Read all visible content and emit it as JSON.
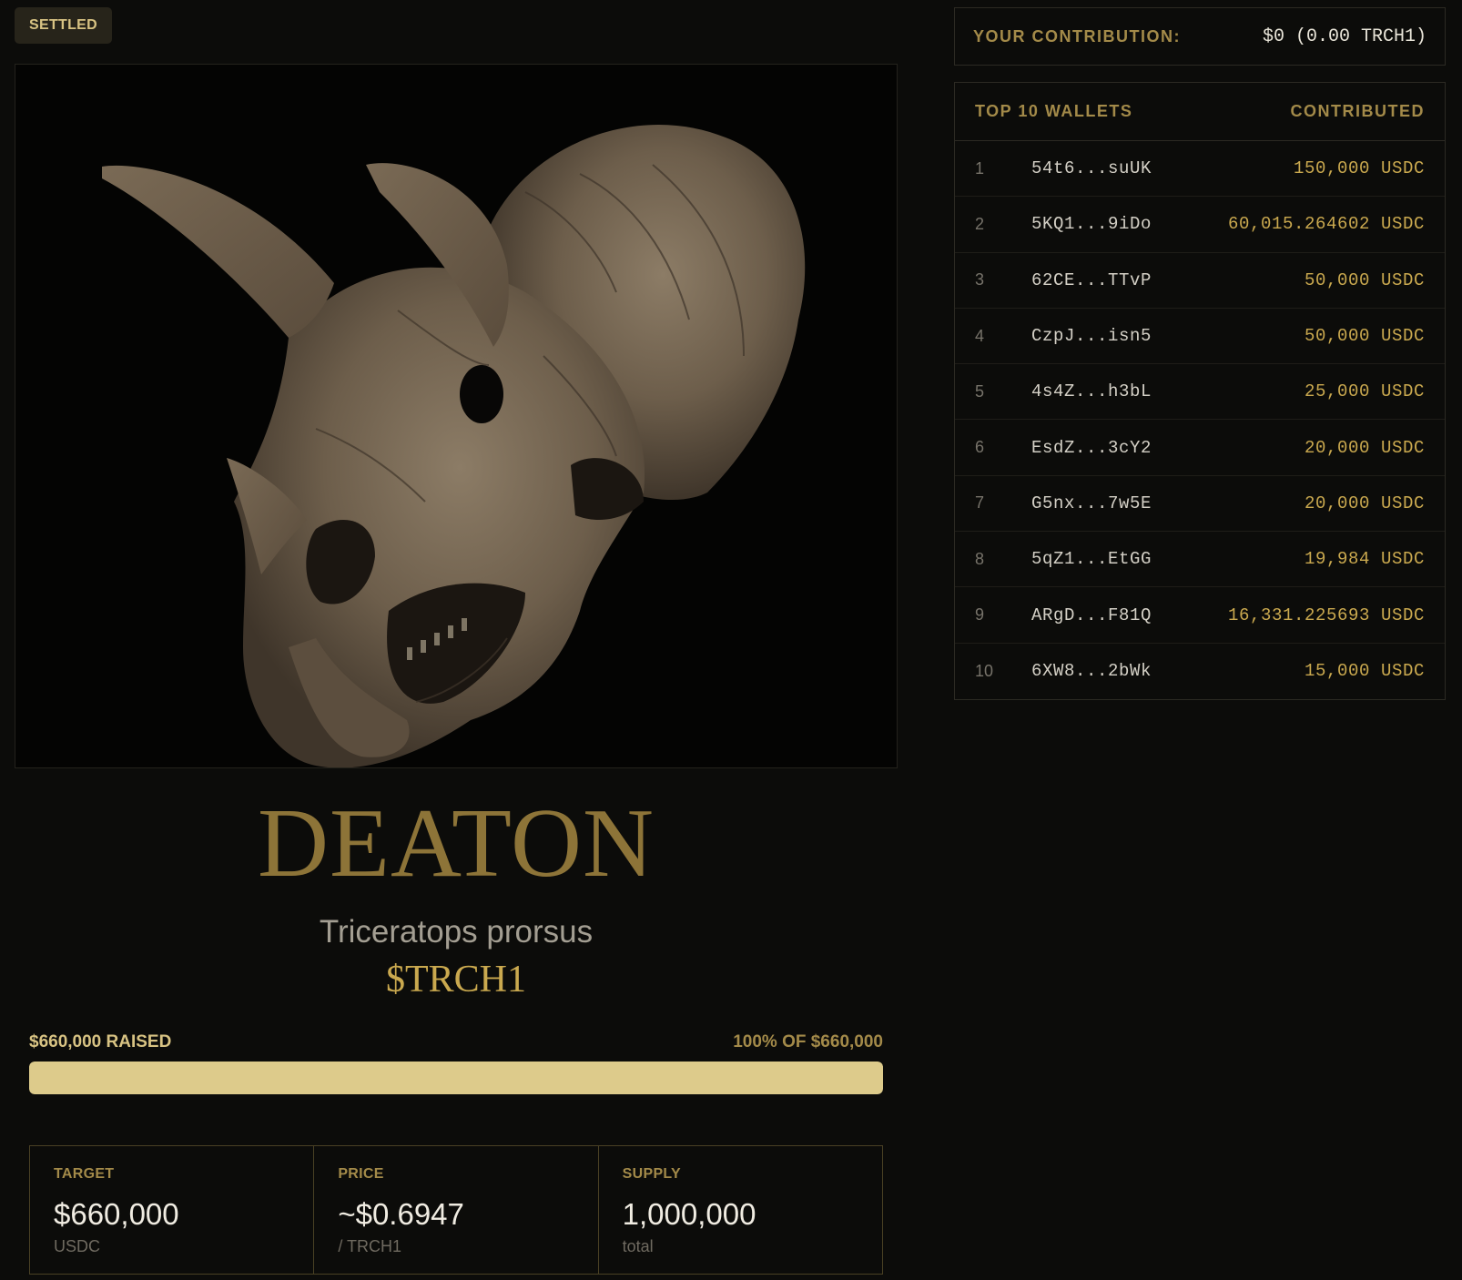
{
  "status": {
    "label": "SETTLED"
  },
  "specimen": {
    "name": "DEATON",
    "species": "Triceratops prorsus",
    "ticker": "$TRCH1",
    "image_icon": "triceratops-skull-image"
  },
  "progress": {
    "raised_label": "$660,000 RAISED",
    "target_label": "100% OF $660,000",
    "percent": 100
  },
  "stats": [
    {
      "label": "TARGET",
      "value": "$660,000",
      "unit": "USDC"
    },
    {
      "label": "PRICE",
      "value": "~$0.6947",
      "unit": "/ TRCH1"
    },
    {
      "label": "SUPPLY",
      "value": "1,000,000",
      "unit": "total"
    }
  ],
  "contribution": {
    "label": "YOUR CONTRIBUTION:",
    "value": "$0 (0.00 TRCH1)"
  },
  "wallets": {
    "header_left": "TOP 10 WALLETS",
    "header_right": "CONTRIBUTED",
    "rows": [
      {
        "rank": "1",
        "address": "54t6...suUK",
        "amount": "150,000 USDC"
      },
      {
        "rank": "2",
        "address": "5KQ1...9iDo",
        "amount": "60,015.264602 USDC"
      },
      {
        "rank": "3",
        "address": "62CE...TTvP",
        "amount": "50,000 USDC"
      },
      {
        "rank": "4",
        "address": "CzpJ...isn5",
        "amount": "50,000 USDC"
      },
      {
        "rank": "5",
        "address": "4s4Z...h3bL",
        "amount": "25,000 USDC"
      },
      {
        "rank": "6",
        "address": "EsdZ...3cY2",
        "amount": "20,000 USDC"
      },
      {
        "rank": "7",
        "address": "G5nx...7w5E",
        "amount": "20,000 USDC"
      },
      {
        "rank": "8",
        "address": "5qZ1...EtGG",
        "amount": "19,984 USDC"
      },
      {
        "rank": "9",
        "address": "ARgD...F81Q",
        "amount": "16,331.225693 USDC"
      },
      {
        "rank": "10",
        "address": "6XW8...2bWk",
        "amount": "15,000 USDC"
      }
    ]
  },
  "colors": {
    "background": "#0c0c0a",
    "accent_gold": "#caa94f",
    "title_gold": "#8d7438",
    "progress_fill": "#ddcb8b"
  }
}
